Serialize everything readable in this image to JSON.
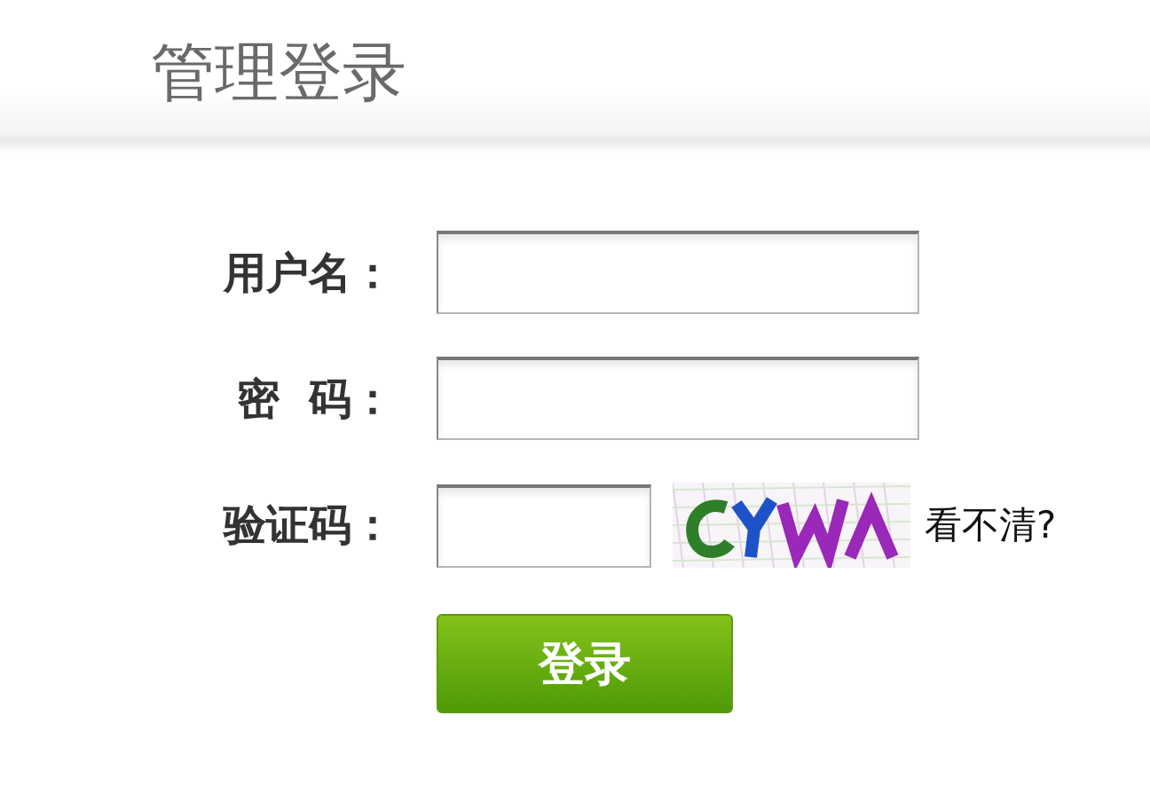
{
  "header": {
    "title": "管理登录"
  },
  "form": {
    "fields": [
      {
        "kind": "text",
        "label": "用户名："
      },
      {
        "kind": "password",
        "label": "密  码："
      },
      {
        "kind": "captcha",
        "label": "验证码：",
        "refresh_link": "看不清?"
      }
    ],
    "submit": "登录"
  }
}
